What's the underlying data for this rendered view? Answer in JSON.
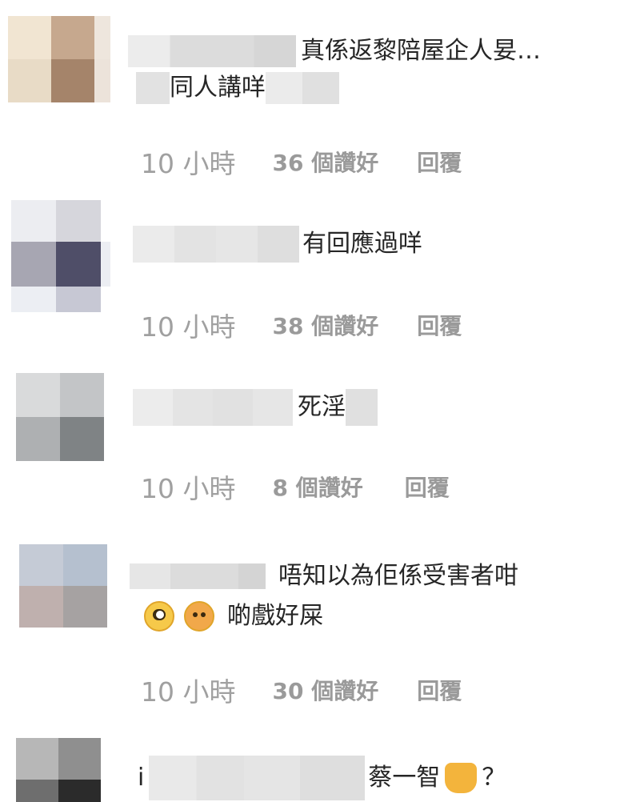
{
  "comments": [
    {
      "avatar": [
        "#f1e5d2",
        "#c6a88e",
        "#eee6dd",
        "#e8dbc6",
        "#a5846a",
        "#ece3da"
      ],
      "text": "真係返黎陪屋企人妟…",
      "text_line2": "同人講咩",
      "time": "10 小時",
      "likes": "36 個讚好",
      "reply": "回覆"
    },
    {
      "avatar": [
        "#ecedf1",
        "#d6d6dc",
        "#a7a6b2",
        "#4f4e68",
        "#eceef3",
        "#c7c8d4"
      ],
      "text": "有回應過咩",
      "time": "10 小時",
      "likes": "38 個讚好",
      "reply": "回覆"
    },
    {
      "avatar": [
        "#d9dadb",
        "#c3c5c7",
        "#aeb0b2",
        "#7f8385"
      ],
      "text": "死淫",
      "time": "10 小時",
      "likes": "8 個讚好",
      "reply": "回覆"
    },
    {
      "avatar": [
        "#c5cbd6",
        "#b5c0cf",
        "#bfb0ae",
        "#a6a2a2"
      ],
      "text": "唔知以為佢係受害者咁",
      "text_line2": "啲戲好屎",
      "emojis": [
        "face-with-rolling-eyes-icon",
        "unamused-face-icon"
      ],
      "time": "10 小時",
      "likes": "30 個讚好",
      "reply": "回覆"
    },
    {
      "avatar": [
        "#b7b7b7",
        "#8f8f8f",
        "#6e6e6e",
        "#2b2b2b"
      ],
      "prefix": "i",
      "text": "蔡一智",
      "suffix": "？",
      "emoji": "crying-cat-face-icon"
    }
  ]
}
